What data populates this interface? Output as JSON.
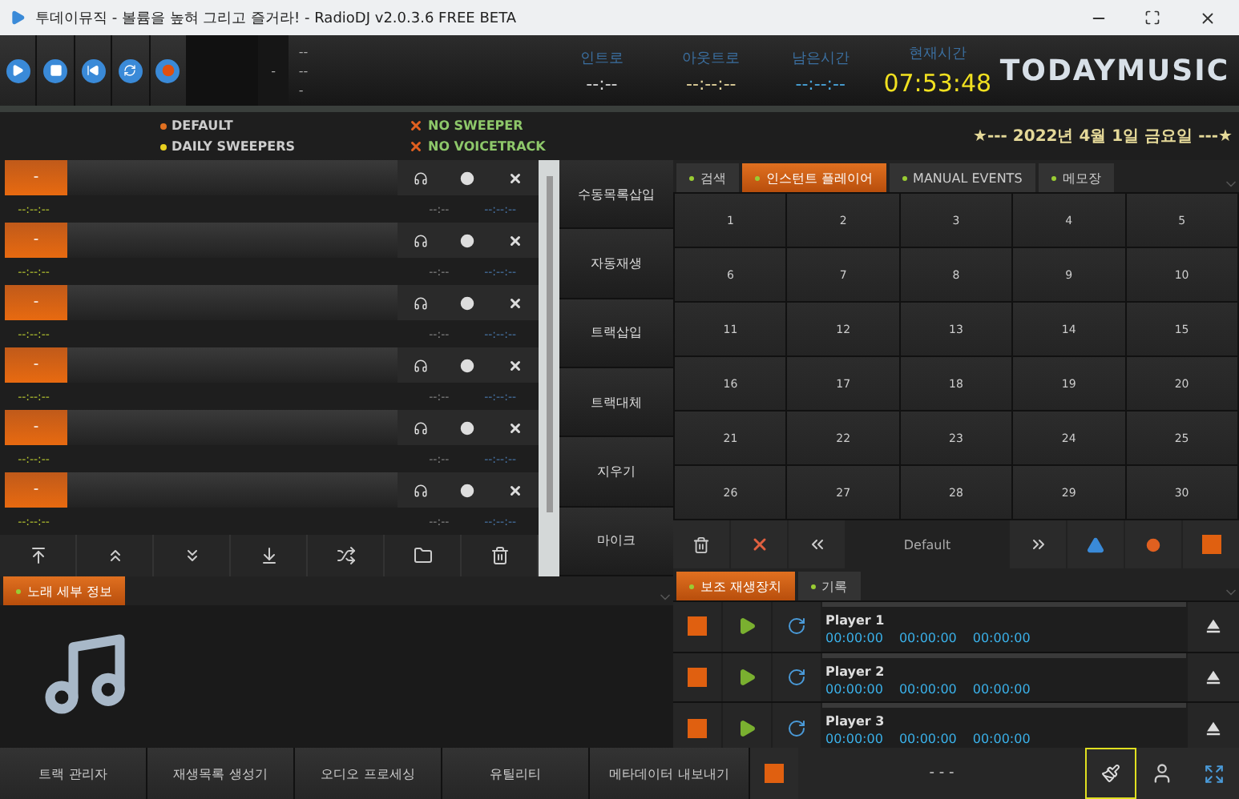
{
  "window": {
    "title": "투데이뮤직 - 볼륨을 높혀 그리고 즐거라! - RadioDJ v2.0.3.6 FREE BETA"
  },
  "transport": [
    {
      "kind": "play"
    },
    {
      "kind": "stop"
    },
    {
      "kind": "previous"
    },
    {
      "kind": "loop"
    },
    {
      "kind": "record"
    }
  ],
  "now_playing": {
    "counter": "-",
    "lines": [
      "--",
      "--",
      "-"
    ]
  },
  "timers": [
    {
      "label": "인트로",
      "value": "--:--",
      "color": "#d8d8d8"
    },
    {
      "label": "아웃트로",
      "value": "--:--:--",
      "color": "#e8d8a0"
    },
    {
      "label": "남은시간",
      "value": "--:--:--",
      "color": "#4aa8e0"
    },
    {
      "label": "현재시간",
      "value": "07:53:48",
      "color": "#f0e020"
    }
  ],
  "brand": "TODAYMUSIC",
  "legend": [
    {
      "label": "DEFAULT",
      "color": "#e07020"
    },
    {
      "label": "DAILY SWEEPERS",
      "color": "#e8d020"
    }
  ],
  "flags": [
    {
      "label": "NO SWEEPER"
    },
    {
      "label": "NO VOICETRACK"
    }
  ],
  "date": "★--- 2022년 4월 1일 금요일 ---★",
  "playlist": [
    {
      "badge": "-",
      "time": "--:--:--",
      "intro": "--:--",
      "outro": "--:--:--"
    },
    {
      "badge": "-",
      "time": "--:--:--",
      "intro": "--:--",
      "outro": "--:--:--"
    },
    {
      "badge": "-",
      "time": "--:--:--",
      "intro": "--:--",
      "outro": "--:--:--"
    },
    {
      "badge": "-",
      "time": "--:--:--",
      "intro": "--:--",
      "outro": "--:--:--"
    },
    {
      "badge": "-",
      "time": "--:--:--",
      "intro": "--:--",
      "outro": "--:--:--"
    },
    {
      "badge": "-",
      "time": "--:--:--",
      "intro": "--:--",
      "outro": "--:--:--"
    }
  ],
  "side_buttons": [
    "수동목록삽입",
    "자동재생",
    "트랙삽입",
    "트랙대체",
    "지우기",
    "마이크"
  ],
  "tabs": [
    {
      "label": "검색",
      "selected": false
    },
    {
      "label": "인스턴트 플레이어",
      "selected": true
    },
    {
      "label": "MANUAL EVENTS",
      "selected": false
    },
    {
      "label": "메모장",
      "selected": false
    }
  ],
  "pads": [
    "1",
    "2",
    "3",
    "4",
    "5",
    "6",
    "7",
    "8",
    "9",
    "10",
    "11",
    "12",
    "13",
    "14",
    "15",
    "16",
    "17",
    "18",
    "19",
    "20",
    "21",
    "22",
    "23",
    "24",
    "25",
    "26",
    "27",
    "28",
    "29",
    "30"
  ],
  "pad_page": "Default",
  "player_tabs": [
    {
      "label": "보조 재생장치",
      "selected": true
    },
    {
      "label": "기록",
      "selected": false
    }
  ],
  "players": [
    {
      "name": "Player 1",
      "times": [
        "00:00:00",
        "00:00:00",
        "00:00:00"
      ]
    },
    {
      "name": "Player 2",
      "times": [
        "00:00:00",
        "00:00:00",
        "00:00:00"
      ]
    },
    {
      "name": "Player 3",
      "times": [
        "00:00:00",
        "00:00:00",
        "00:00:00"
      ]
    }
  ],
  "info_tabs": [
    {
      "label": "노래 세부 정보",
      "selected": true
    }
  ],
  "bottom_buttons": [
    "트랙 관리자",
    "재생목록 생성기",
    "오디오 프로세싱",
    "유틸리티",
    "메타데이터 내보내기"
  ],
  "status": "- - -"
}
